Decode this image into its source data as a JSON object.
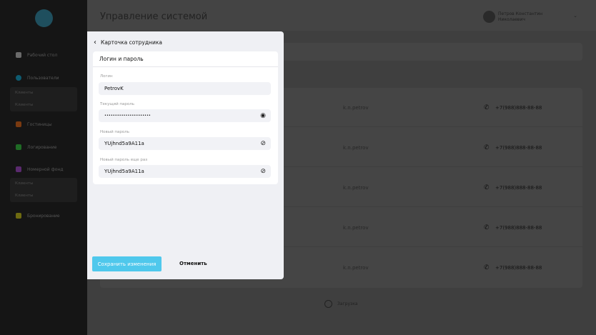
{
  "sidebar": {
    "items": [
      {
        "label": "Рабочий стол",
        "color": "#6a6a6a"
      },
      {
        "label": "Пользователи",
        "color": "#0e5b70"
      },
      {
        "label": "Гостиницы",
        "color": "#7a3a10"
      },
      {
        "label": "Логирование",
        "color": "#1f6b25"
      },
      {
        "label": "Номерной фонд",
        "color": "#5a2a6e"
      },
      {
        "label": "Бронирование",
        "color": "#6e6a10"
      }
    ],
    "sub1": [
      "Клиенты",
      "Клиенты"
    ],
    "sub2": [
      "Клиенты",
      "Клиенты"
    ]
  },
  "header": {
    "title": "Управление системой",
    "user_line1": "Петров Константин",
    "user_line2": "Николаевич"
  },
  "table": {
    "rows": [
      {
        "login": "k.n.petrov",
        "phone": "+7(988)888-88-88"
      },
      {
        "login": "k.n.petrov",
        "phone": "+7(988)888-88-88"
      },
      {
        "login": "k.n.petrov",
        "phone": "+7(988)888-88-88"
      },
      {
        "login": "k.n.petrov",
        "phone": "+7(988)888-88-88"
      },
      {
        "login": "k.n.petrov",
        "phone": "+7(988)888-88-88"
      }
    ]
  },
  "loading": "Загрузка",
  "modal": {
    "title": "Карточка сотрудника",
    "section": "Логин и пароль",
    "fields": [
      {
        "label": "Логин",
        "value": "PetrovK"
      },
      {
        "label": "Текущий пароль",
        "value": "••••••••••••••••••••••"
      },
      {
        "label": "Новый пароль",
        "value": "YUjhnd5a9A11a"
      },
      {
        "label": "Новый пароль еще раз",
        "value": "YUjhnd5a9A11a"
      }
    ],
    "save": "Сохранить изменения",
    "cancel": "Отменить"
  }
}
